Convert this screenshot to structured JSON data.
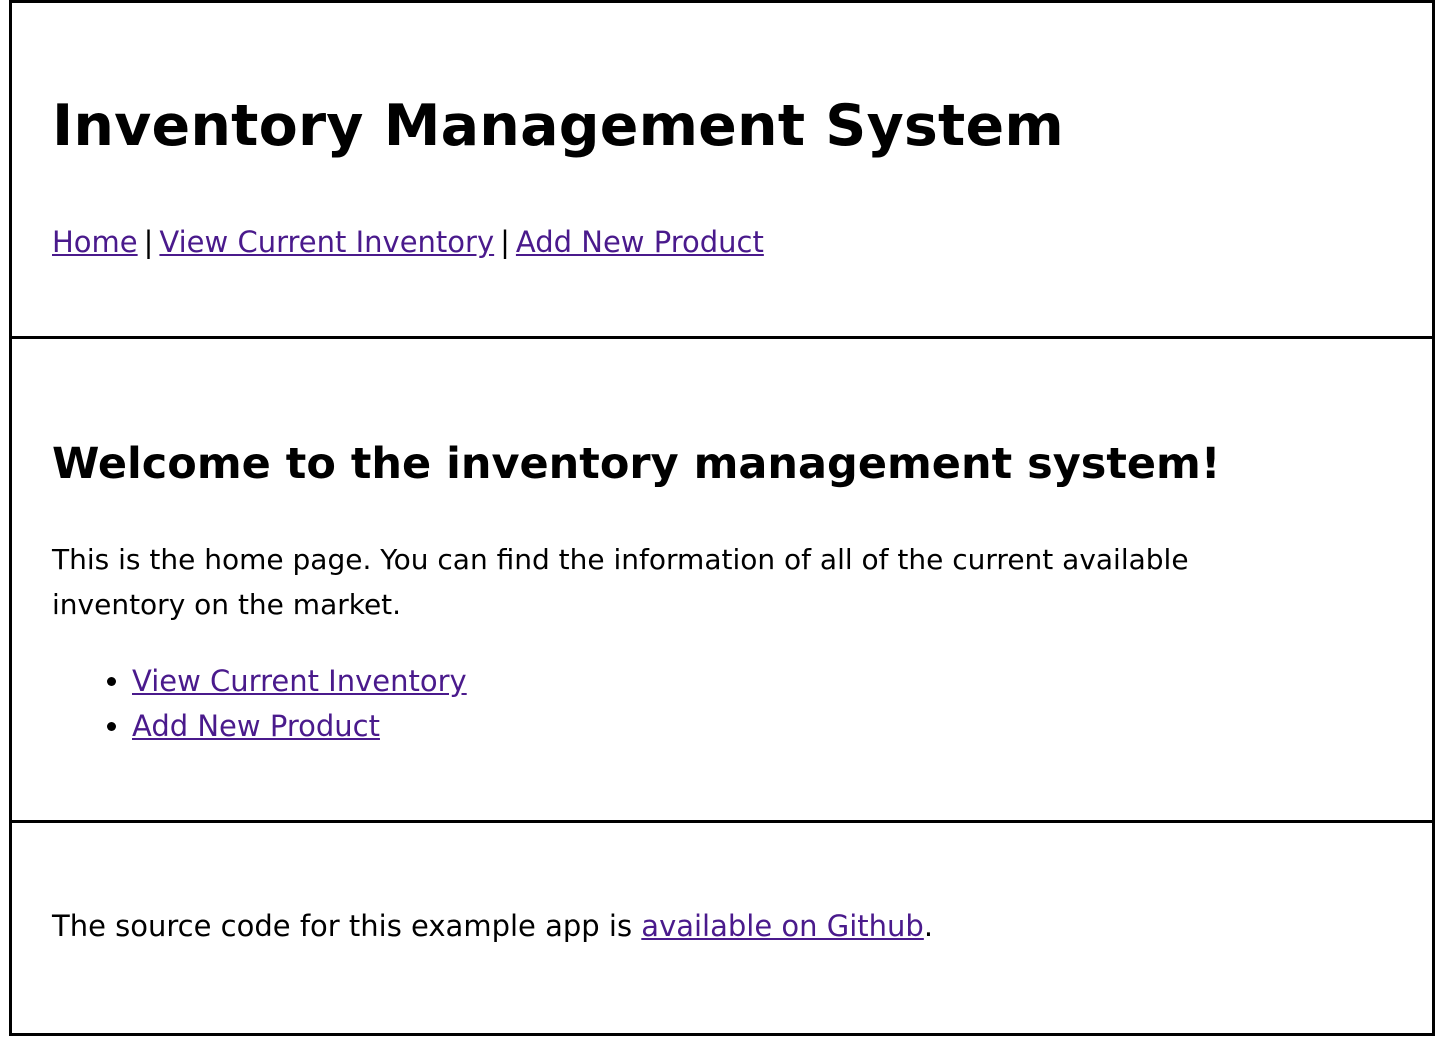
{
  "header": {
    "title": "Inventory Management System",
    "nav": {
      "home": "Home",
      "view_inventory": "View Current Inventory",
      "add_product": "Add New Product",
      "separator": "|"
    }
  },
  "main": {
    "heading": "Welcome to the inventory management system!",
    "intro": "This is the home page. You can find the information of all of the current available inventory on the market.",
    "links": [
      {
        "label": "View Current Inventory"
      },
      {
        "label": "Add New Product"
      }
    ]
  },
  "footer": {
    "text_before": "The source code for this example app is ",
    "link": "available on Github",
    "text_after": "."
  },
  "colors": {
    "link": "#4a1a8c",
    "border": "#000000",
    "text": "#000000",
    "background": "#ffffff"
  }
}
